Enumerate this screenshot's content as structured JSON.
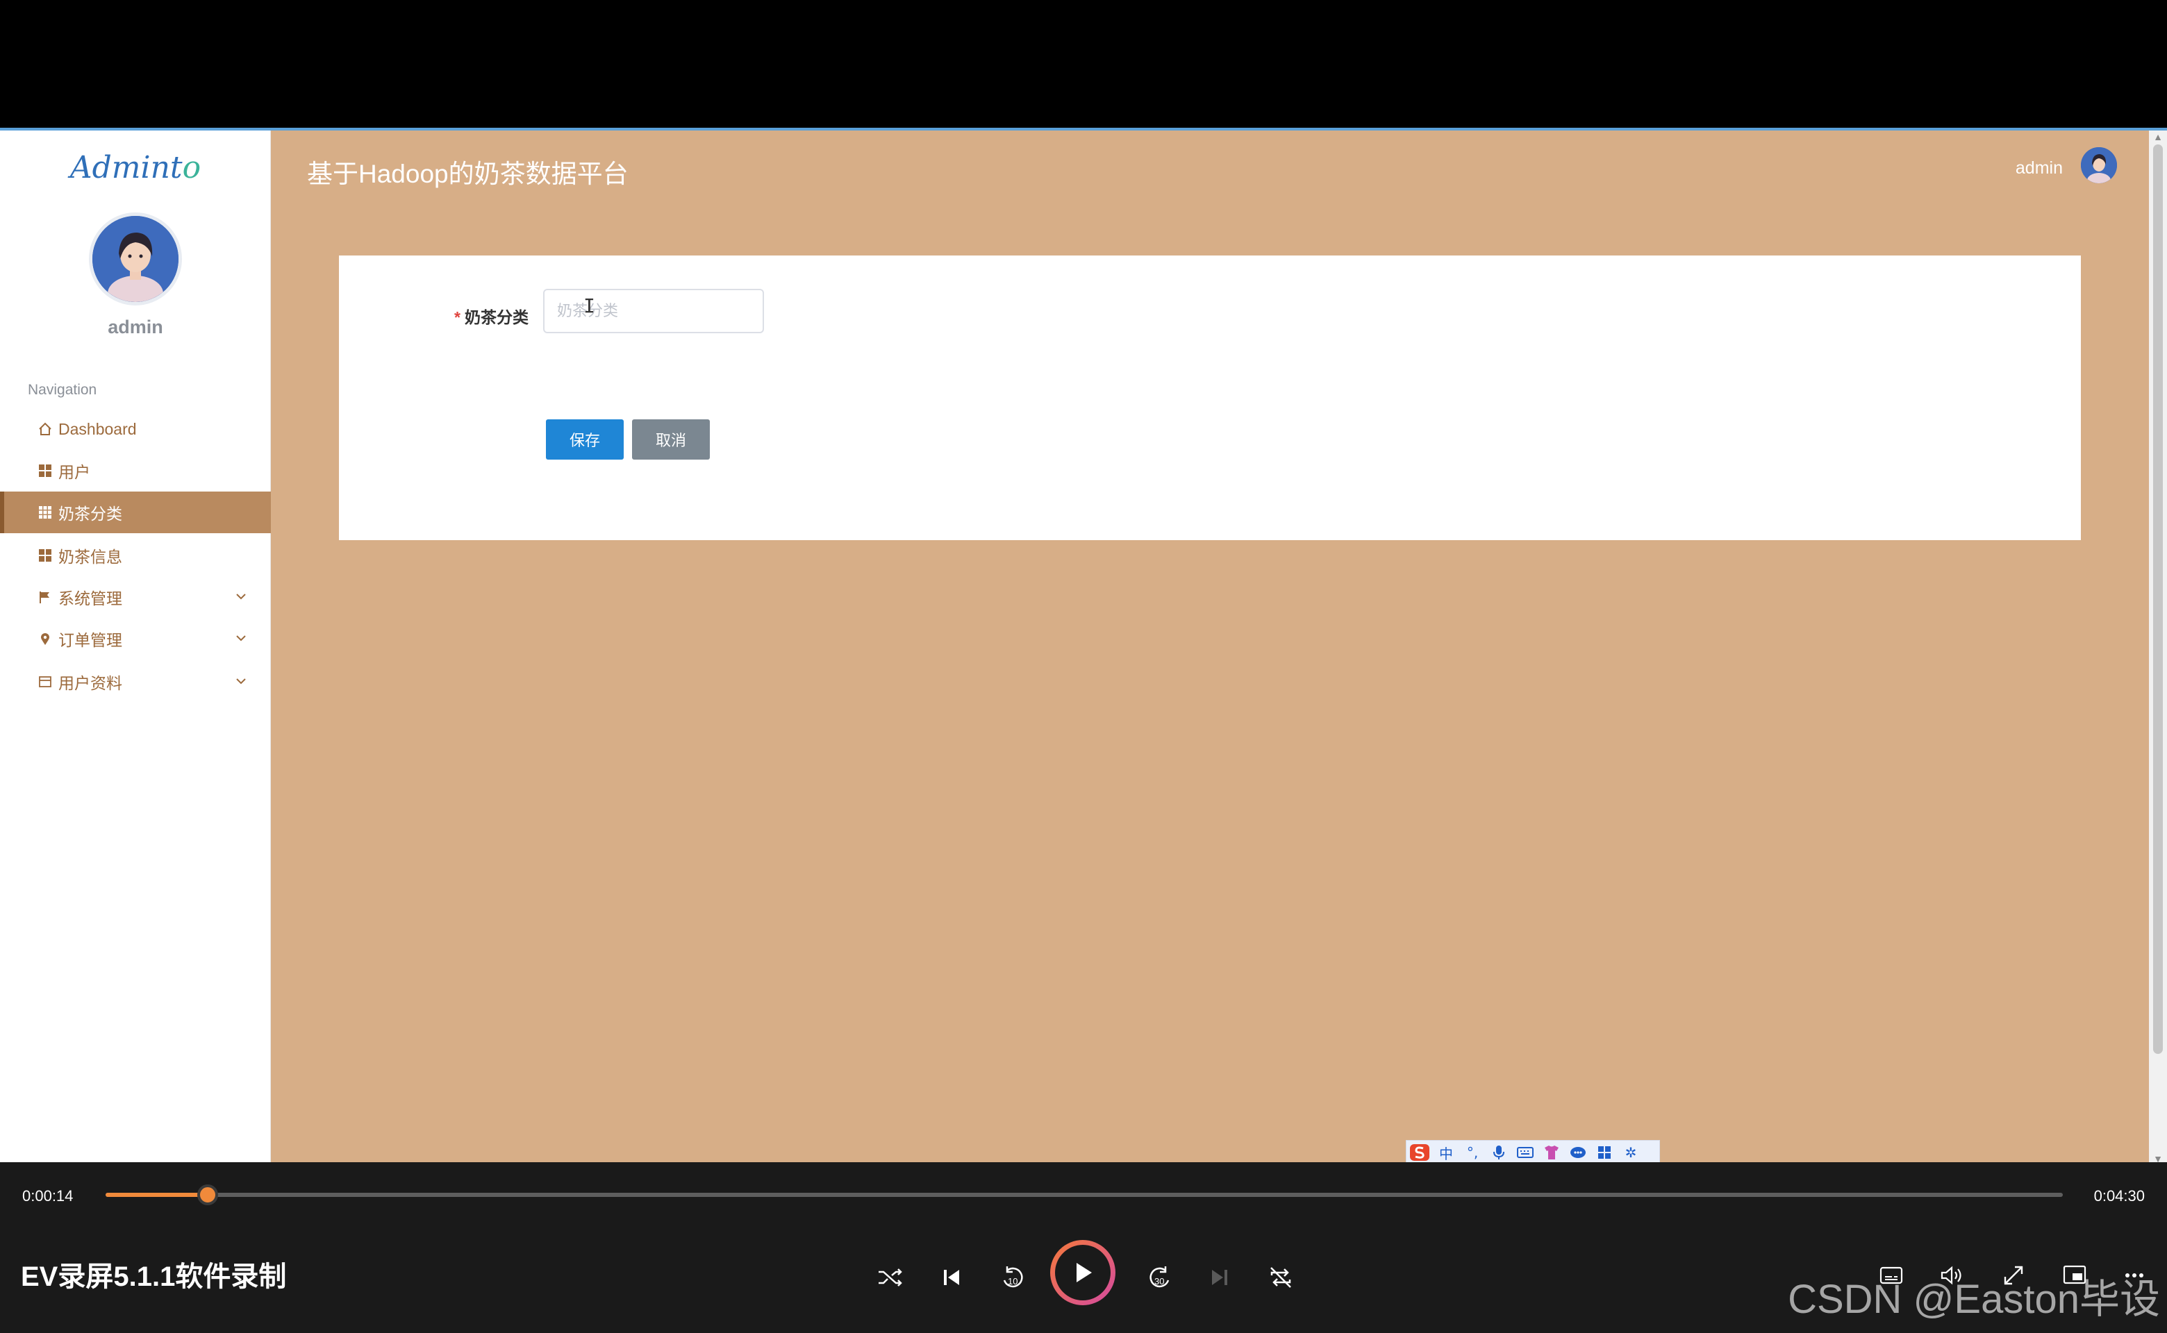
{
  "app": {
    "logo_prefix": "Admint",
    "logo_suffix": "o",
    "title": "基于Hadoop的奶茶数据平台"
  },
  "sidebar": {
    "username": "admin",
    "nav_title": "Navigation",
    "items": [
      {
        "label": "Dashboard",
        "icon": "home-icon"
      },
      {
        "label": "用户",
        "icon": "grid-icon"
      },
      {
        "label": "奶茶分类",
        "icon": "grid-icon",
        "active": true
      },
      {
        "label": "奶茶信息",
        "icon": "grid-icon"
      },
      {
        "label": "系统管理",
        "icon": "flag-icon",
        "expandable": true
      },
      {
        "label": "订单管理",
        "icon": "pin-icon",
        "expandable": true
      },
      {
        "label": "用户资料",
        "icon": "card-icon",
        "expandable": true
      }
    ]
  },
  "header": {
    "username": "admin"
  },
  "form": {
    "field_label": "奶茶分类",
    "required_mark": "*",
    "field_value": "",
    "field_placeholder": "奶茶分类",
    "save_label": "保存",
    "cancel_label": "取消"
  },
  "ime": {
    "mode": "中",
    "icons": [
      "sogou-logo-icon",
      "chinese-mode-icon",
      "punctuation-icon",
      "microphone-icon",
      "keyboard-icon",
      "skin-icon",
      "chat-icon",
      "apps-icon",
      "settings-icon"
    ]
  },
  "player": {
    "current_time": "0:00:14",
    "total_time": "0:04:30",
    "progress": 0.052,
    "title": "EV录屏5.1.1软件录制",
    "accent_color": "#f08a3b",
    "watermark": "CSDN @Easton毕设"
  },
  "colors": {
    "page_bg": "#d7ae87",
    "active_nav": "#b98a5f",
    "primary_button": "#1f86d6",
    "secondary_button": "#7b8791"
  }
}
